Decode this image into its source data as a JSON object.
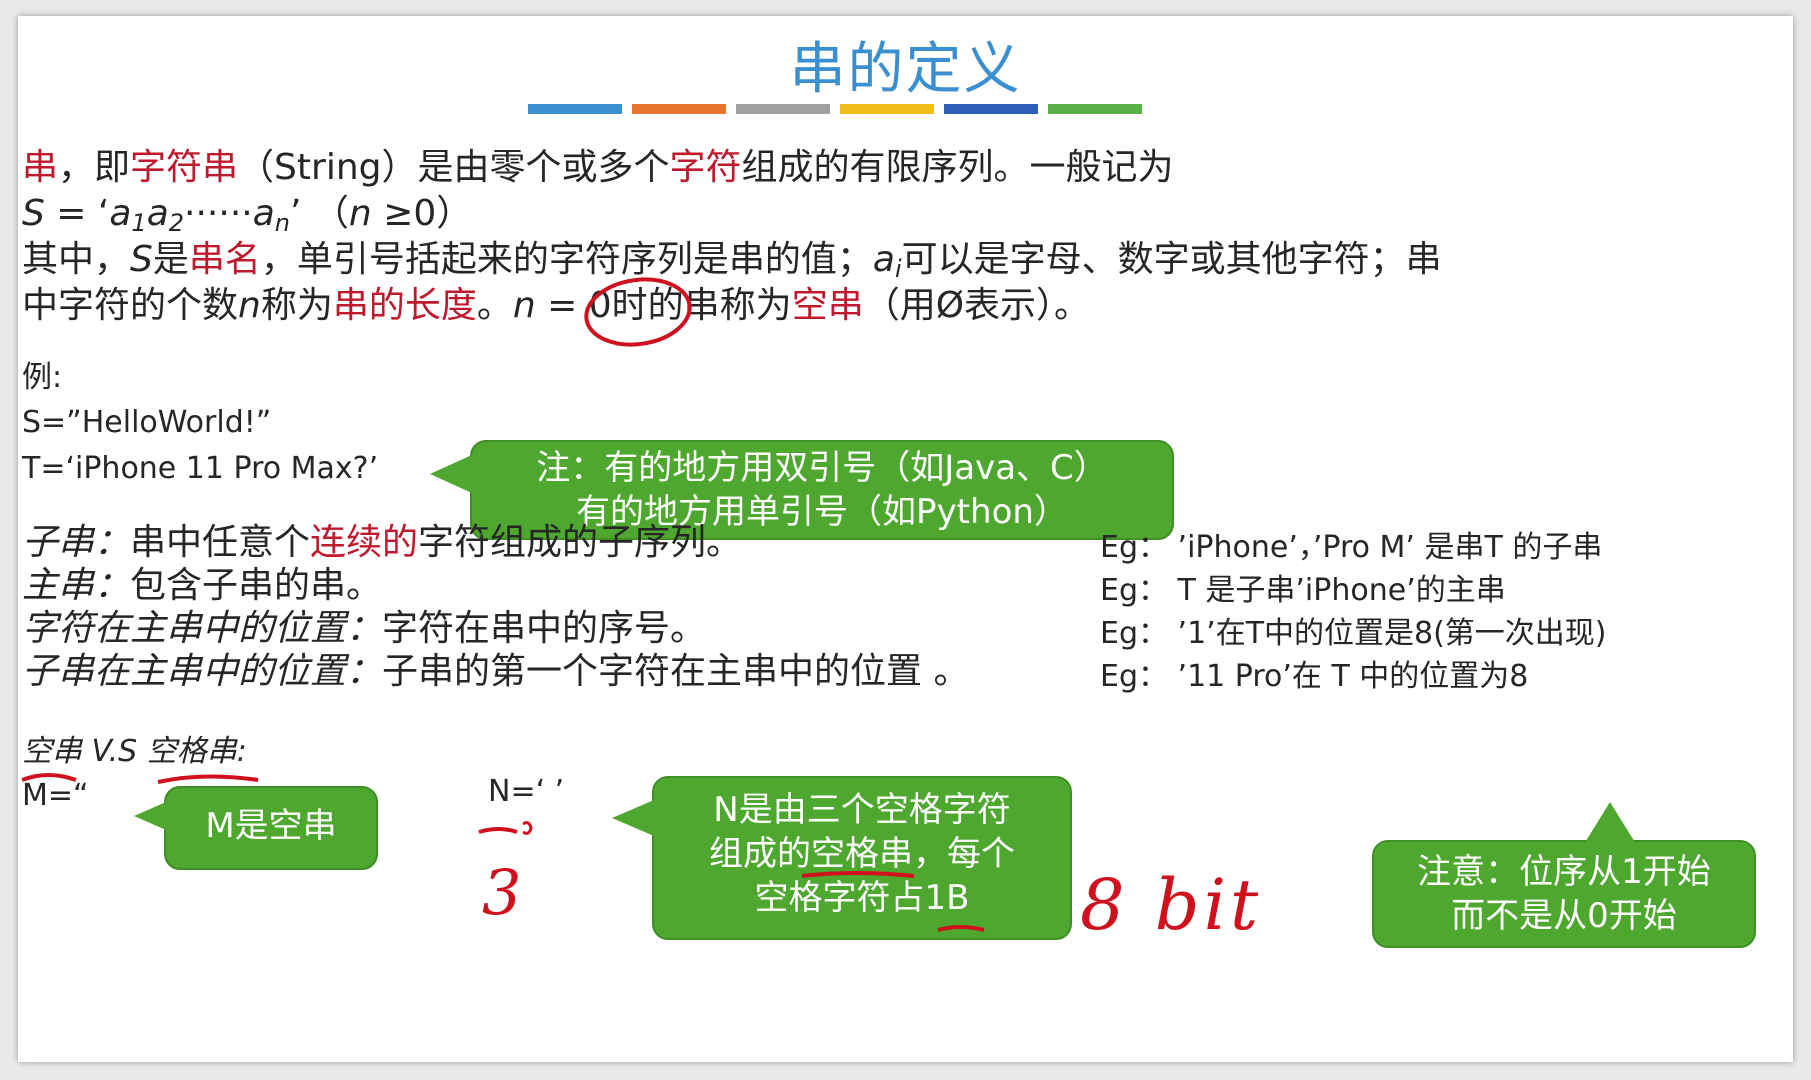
{
  "title": "串的定义",
  "underline_colors": [
    "#3a8fd0",
    "#e8742c",
    "#a0a0a0",
    "#f2bd1b",
    "#2e5fb7",
    "#5ab046"
  ],
  "definition": {
    "l1_a": "串",
    "l1_b": "，即",
    "l1_c": "字符串",
    "l1_d": "（String）是由零个或多个",
    "l1_e": "字符",
    "l1_f": "组成的有限序列。一般记为",
    "l2_s": "S",
    "l2_eq": " = ‘",
    "l2_a1": "a",
    "l2_1": "1",
    "l2_a2": "a",
    "l2_2": "2",
    "l2_dots": "······",
    "l2_an": "a",
    "l2_n": "n",
    "l2_tail": "’ （",
    "l2_nvar": "n",
    "l2_cond": " ≥0）",
    "l3_a": "其中，",
    "l3_s": "S",
    "l3_b": "是",
    "l3_c": "串名",
    "l3_d": "，单引号括起来的字符序列是串的值；",
    "l3_ai": "a",
    "l3_i": "i",
    "l3_e": "可以是字母、数字或其他字符；串",
    "l4_a": "中字符的个数",
    "l4_n": "n",
    "l4_b": "称为",
    "l4_c": "串的长度",
    "l4_d": "。",
    "l4_n2": "n",
    "l4_e": " = 0时的串称为",
    "l4_f": "空串",
    "l4_g": "（用Ø表示）。"
  },
  "example": {
    "label": "例:",
    "s": "S=”HelloWorld!”",
    "t": "T=‘iPhone 11 Pro Max?’"
  },
  "note_quotes": {
    "line1": "注：有的地方用双引号（如Java、C）",
    "line2": "有的地方用单引号（如Python）"
  },
  "terms": {
    "sub_a": "子串：",
    "sub_b": "串中任意个",
    "sub_c": "连续的",
    "sub_d": "字符组成的子序列。",
    "main_a": "主串：",
    "main_b": "包含子串的串。",
    "cpos_a": "字符在主串中的位置：",
    "cpos_b": "字符在串中的序号。",
    "spos_a": "子串在主串中的位置：",
    "spos_b": "子串的第一个字符在主串中的位置 。"
  },
  "eg": [
    "Eg： ’iPhone’，’Pro M’ 是串T 的子串",
    "Eg： T 是子串’iPhone’的主串",
    "Eg： ’1’在T中的位置是8(第一次出现)",
    "Eg： ’11 Pro’在 T 中的位置为8"
  ],
  "note_position": {
    "line1": "注意：位序从1开始",
    "line2": "而不是从0开始"
  },
  "empty_vs": {
    "a": "空串",
    "b": " V.S ",
    "c": "空格串",
    "d": ":",
    "m": "M=“",
    "n": "N=‘   ’"
  },
  "note_empty": {
    "text": "M是空串"
  },
  "note_space": {
    "line1": "N是由三个空格字符",
    "line2": "组成的空格串，每个",
    "line3": "空格字符占1B"
  },
  "handwriting": {
    "three": "3",
    "bits": "8 bit"
  }
}
